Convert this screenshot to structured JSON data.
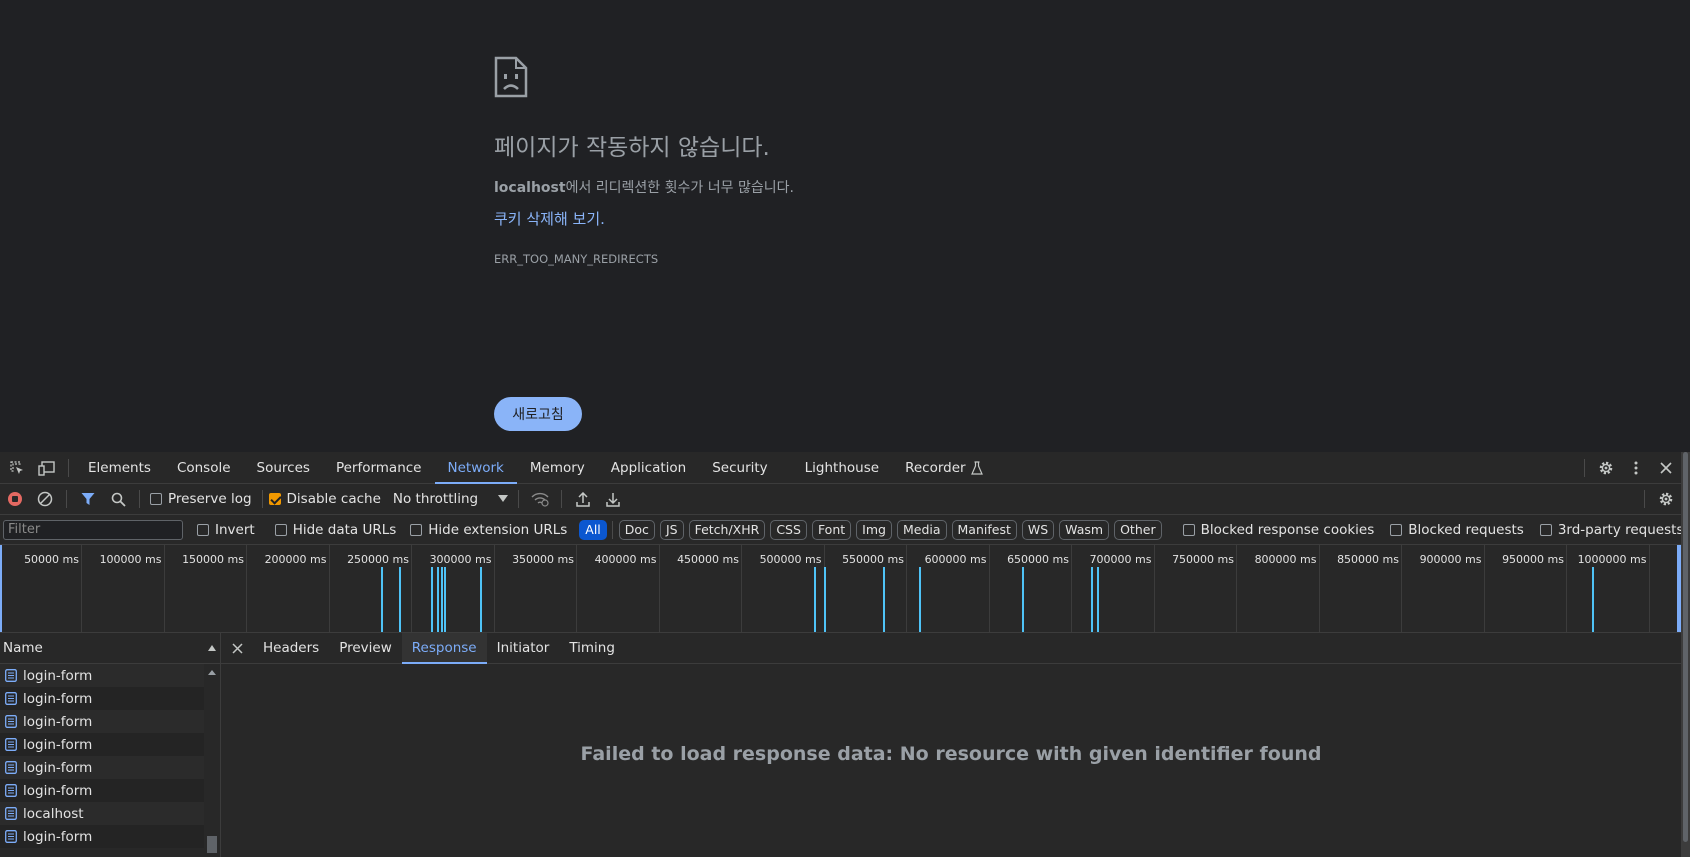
{
  "error_page": {
    "title": "페이지가 작동하지 않습니다.",
    "host": "localhost",
    "description_suffix": "에서 리디렉션한 횟수가 너무 많습니다.",
    "link": "쿠키 삭제해 보기.",
    "error_code": "ERR_TOO_MANY_REDIRECTS",
    "reload_button": "새로고침"
  },
  "devtools": {
    "tabs": [
      "Elements",
      "Console",
      "Sources",
      "Performance",
      "Network",
      "Memory",
      "Application",
      "Security",
      "Lighthouse",
      "Recorder"
    ],
    "active_tab": "Network",
    "toolbar": {
      "preserve_log": "Preserve log",
      "disable_cache": "Disable cache",
      "throttling": "No throttling"
    },
    "filter": {
      "placeholder": "Filter",
      "invert": "Invert",
      "hide_data_urls": "Hide data URLs",
      "hide_extension_urls": "Hide extension URLs",
      "types": [
        "All",
        "Doc",
        "JS",
        "Fetch/XHR",
        "CSS",
        "Font",
        "Img",
        "Media",
        "Manifest",
        "WS",
        "Wasm",
        "Other"
      ],
      "active_type": "All",
      "blocked_response_cookies": "Blocked response cookies",
      "blocked_requests": "Blocked requests",
      "third_party_requests": "3rd-party requests"
    },
    "timeline": {
      "ticks": [
        "50000 ms",
        "100000 ms",
        "150000 ms",
        "200000 ms",
        "250000 ms",
        "300000 ms",
        "350000 ms",
        "400000 ms",
        "450000 ms",
        "500000 ms",
        "550000 ms",
        "600000 ms",
        "650000 ms",
        "700000 ms",
        "750000 ms",
        "800000 ms",
        "850000 ms",
        "900000 ms",
        "950000 ms",
        "1000000 ms"
      ],
      "request_marks_ms": [
        232000,
        243000,
        262000,
        266000,
        268000,
        270000,
        292000,
        494000,
        500000,
        536000,
        558000,
        620000,
        662000,
        666000,
        966000
      ]
    },
    "requests": {
      "header": "Name",
      "items": [
        "login-form",
        "login-form",
        "login-form",
        "login-form",
        "login-form",
        "login-form",
        "localhost",
        "login-form"
      ]
    },
    "detail": {
      "tabs": [
        "Headers",
        "Preview",
        "Response",
        "Initiator",
        "Timing"
      ],
      "active_tab": "Response",
      "message": "Failed to load response data: No resource with given identifier found"
    }
  }
}
